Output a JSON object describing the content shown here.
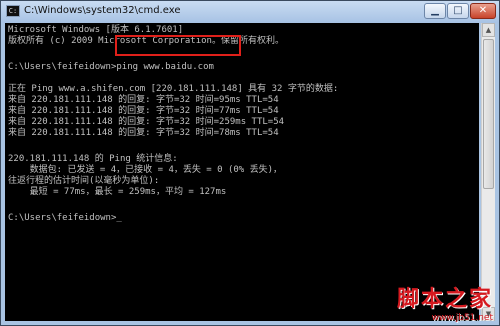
{
  "window": {
    "title": "C:\\Windows\\system32\\cmd.exe",
    "controls": {
      "minimize": "▁",
      "maximize": "□",
      "close": "✕"
    }
  },
  "console": {
    "lines": [
      "Microsoft Windows [版本 6.1.7601]",
      "版权所有 (c) 2009 Microsoft Corporation。保留所有权利。",
      "",
      "C:\\Users\\feifeidown>ping www.baidu.com",
      "",
      "正在 Ping www.a.shifen.com [220.181.111.148] 具有 32 字节的数据:",
      "来自 220.181.111.148 的回复: 字节=32 时间=95ms TTL=54",
      "来自 220.181.111.148 的回复: 字节=32 时间=77ms TTL=54",
      "来自 220.181.111.148 的回复: 字节=32 时间=259ms TTL=54",
      "来自 220.181.111.148 的回复: 字节=32 时间=78ms TTL=54",
      "",
      "220.181.111.148 的 Ping 统计信息:",
      "    数据包: 已发送 = 4，已接收 = 4，丢失 = 0 (0% 丢失)，",
      "往返行程的估计时间(以毫秒为单位):",
      "    最短 = 77ms，最长 = 259ms，平均 = 127ms",
      "",
      "C:\\Users\\feifeidown>_"
    ]
  },
  "scrollbar": {
    "up": "▲",
    "down": "▼"
  },
  "watermark": {
    "logo": "脚本之家",
    "url": "www.jb51.net"
  },
  "colors": {
    "console_bg": "#000000",
    "console_text": "#c0c0c0",
    "highlight": "#e0201a"
  }
}
